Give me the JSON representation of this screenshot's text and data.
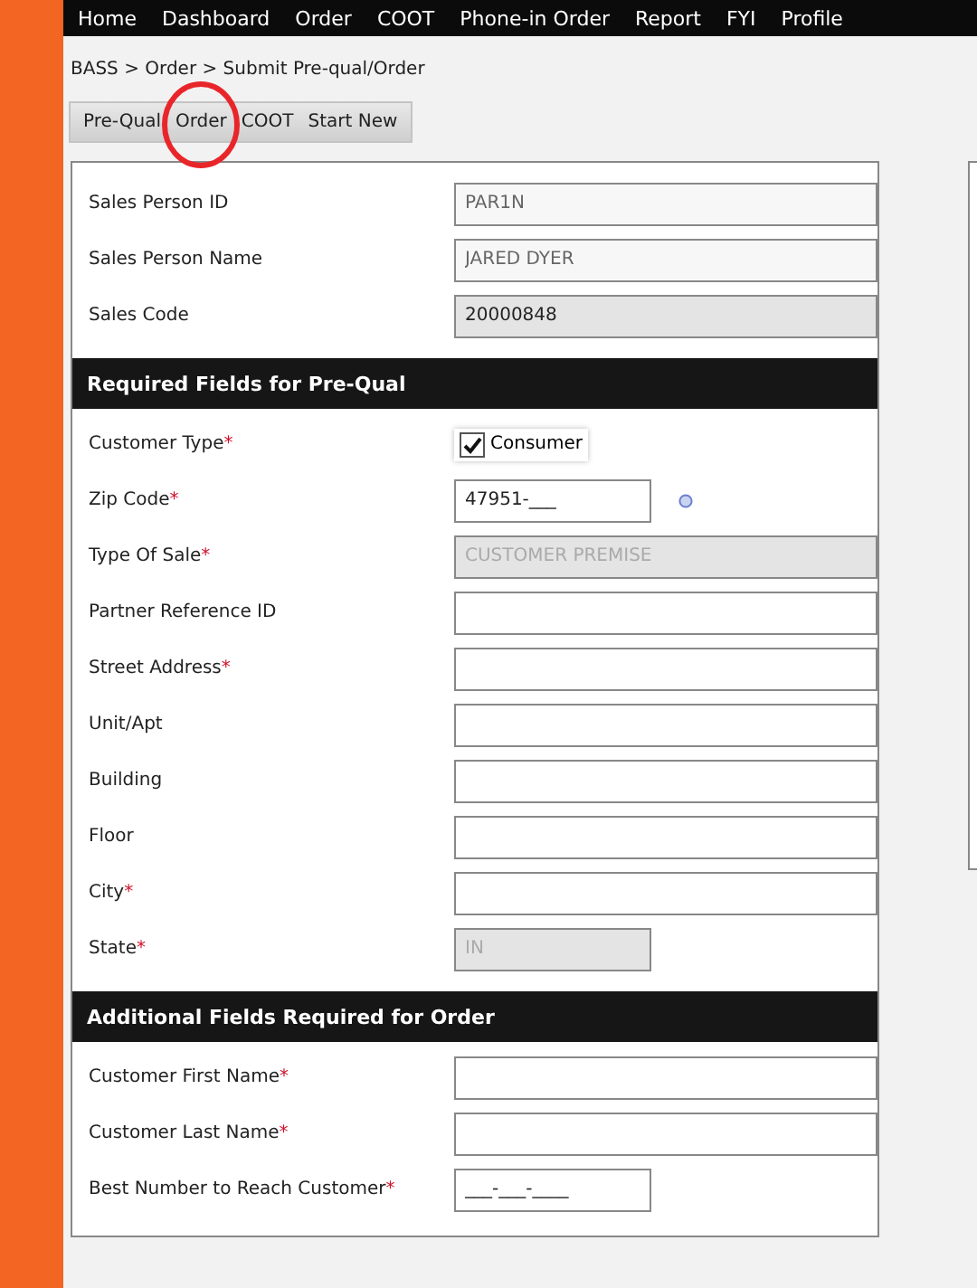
{
  "nav": [
    {
      "label": "Home"
    },
    {
      "label": "Dashboard"
    },
    {
      "label": "Order"
    },
    {
      "label": "COOT"
    },
    {
      "label": "Phone-in Order"
    },
    {
      "label": "Report"
    },
    {
      "label": "FYI"
    },
    {
      "label": "Profile"
    }
  ],
  "breadcrumb": "BASS > Order > Submit Pre-qual/Order",
  "tabs": [
    {
      "label": "Pre-Qual"
    },
    {
      "label": "Order"
    },
    {
      "label": "COOT"
    },
    {
      "label": "Start New"
    }
  ],
  "sections": [
    {
      "fields": [
        {
          "label": "Sales Person ID",
          "kind": "text",
          "value": "PAR1N",
          "readonly": true
        },
        {
          "label": "Sales Person Name",
          "kind": "text",
          "value": "JARED DYER",
          "readonly": true
        },
        {
          "label": "Sales Code",
          "kind": "text",
          "value": "20000848",
          "disabled": true
        }
      ]
    },
    {
      "title": "Required Fields for Pre-Qual",
      "fields": [
        {
          "label": "Customer Type",
          "required_mark": "*",
          "kind": "checkbox",
          "option": "Consumer",
          "checked": true
        },
        {
          "label": "Zip Code",
          "required_mark": "*",
          "kind": "short",
          "value": "47951-___",
          "help": true
        },
        {
          "label": "Type Of Sale",
          "required_mark": "*",
          "kind": "text",
          "value": "CUSTOMER PREMISE",
          "disabled": true,
          "readonly": true
        },
        {
          "label": "Partner Reference ID",
          "kind": "text"
        },
        {
          "label": "Street Address",
          "required_mark": "*",
          "kind": "text"
        },
        {
          "label": "Unit/Apt",
          "kind": "text"
        },
        {
          "label": "Building",
          "kind": "text"
        },
        {
          "label": "Floor",
          "kind": "text"
        },
        {
          "label": "City",
          "required_mark": "*",
          "kind": "text"
        },
        {
          "label": "State",
          "required_mark": "*",
          "kind": "short",
          "value": "IN",
          "disabled": true,
          "readonly": true
        }
      ]
    },
    {
      "title": "Additional Fields Required for Order",
      "fields": [
        {
          "label": "Customer First Name",
          "required_mark": "*",
          "kind": "text"
        },
        {
          "label": "Customer Last Name",
          "required_mark": "*",
          "kind": "text"
        },
        {
          "label": "Best Number to Reach Customer",
          "required_mark": "*",
          "kind": "short",
          "value": "___-___-____"
        }
      ]
    }
  ]
}
